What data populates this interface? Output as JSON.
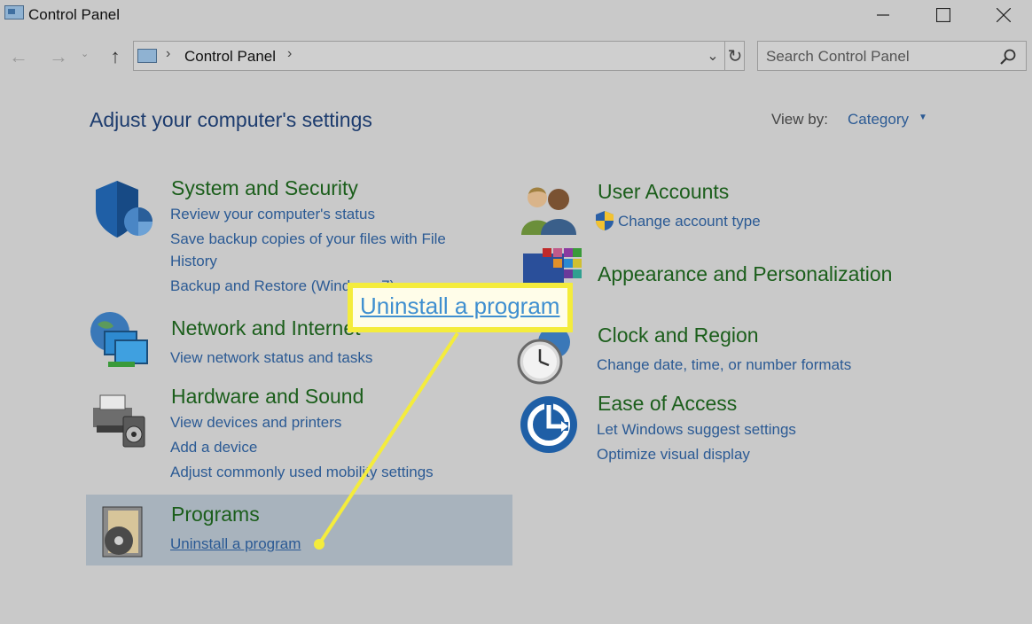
{
  "window": {
    "title": "Control Panel"
  },
  "address": {
    "path": "Control Panel"
  },
  "search": {
    "placeholder": "Search Control Panel"
  },
  "main": {
    "heading": "Adjust your computer's settings",
    "view_by_label": "View by:",
    "view_by_value": "Category"
  },
  "categories": [
    {
      "title": "System and Security",
      "icon": "shield-icon",
      "links": [
        "Review your computer's status",
        "Save backup copies of your files with File",
        "History",
        "Backup and Restore (Windows 7)"
      ]
    },
    {
      "title": "Network and Internet",
      "icon": "network-icon",
      "links": [
        "View network status and tasks"
      ]
    },
    {
      "title": "Hardware and Sound",
      "icon": "printer-icon",
      "links": [
        "View devices and printers",
        "Add a device",
        "Adjust commonly used mobility settings"
      ]
    },
    {
      "title": "Programs",
      "icon": "programs-icon",
      "links": [
        "Uninstall a program"
      ]
    },
    {
      "title": "User Accounts",
      "icon": "users-icon",
      "links": [
        "Change account type"
      ]
    },
    {
      "title": "Appearance and Personalization",
      "icon": "appearance-icon",
      "links": []
    },
    {
      "title": "Clock and Region",
      "icon": "clock-icon",
      "links": [
        "Change date, time, or number formats"
      ]
    },
    {
      "title": "Ease of Access",
      "icon": "ease-of-access-icon",
      "links": [
        "Let Windows suggest settings",
        "Optimize visual display"
      ]
    }
  ],
  "callout": {
    "text": "Uninstall a program"
  },
  "colors": {
    "link": "#2b5a94",
    "category_title": "#1b5e1b",
    "heading": "#1d3c6e",
    "callout_border": "#f4ec3c",
    "highlight": "#a8b3bd"
  }
}
